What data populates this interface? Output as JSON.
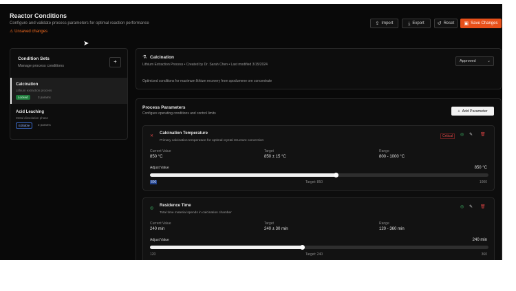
{
  "header": {
    "title": "Reactor Conditions",
    "subtitle": "Configure and validate process parameters for optimal reaction performance",
    "unsaved": "Unsaved changes",
    "buttons": {
      "import": "Import",
      "export": "Export",
      "reset": "Reset",
      "save": "Save Changes"
    }
  },
  "sidebar": {
    "title": "Condition Sets",
    "subtitle": "Manage process conditions",
    "add": "+",
    "items": [
      {
        "name": "Calcination",
        "desc": "Lithium extraction process",
        "status": "Locked",
        "params": "3 params"
      },
      {
        "name": "Acid Leaching",
        "desc": "Metal dissolution phase",
        "status": "Editable",
        "params": "2 params"
      }
    ]
  },
  "set": {
    "name": "Calcination",
    "meta": "Lithium Extraction Process • Created by Dr. Sarah Chen • Last modified 3/15/2024",
    "desc": "Optimized conditions for maximum lithium recovery from spodumene ore concentrate",
    "status": "Approved"
  },
  "process": {
    "title": "Process Parameters",
    "subtitle": "Configure operating conditions and control limits",
    "add_button": "Add Parameter",
    "params": [
      {
        "name": "Calcination Temperature",
        "desc": "Primary calcination temperature for optimal crystal structure conversion",
        "badge": "Critical",
        "current_label": "Current Value",
        "current": "850 °C",
        "target_label": "Target",
        "target": "850 ± 15 °C",
        "range_label": "Range",
        "range": "800 - 1000 °C",
        "adjust_label": "Adjust Value",
        "adjust_value": "850 °C",
        "slider_fraction": 0.55,
        "min": "800",
        "mid": "Target: 850",
        "max": "1000"
      },
      {
        "name": "Residence Time",
        "desc": "Total time material spends in calcination chamber",
        "current_label": "Current Value",
        "current": "240 min",
        "target_label": "Target",
        "target": "240 ± 30 min",
        "range_label": "Range",
        "range": "120 - 360 min",
        "adjust_label": "Adjust Value",
        "adjust_value": "240 min",
        "slider_fraction": 0.45,
        "min": "120",
        "mid": "Target: 240",
        "max": "360"
      }
    ]
  }
}
